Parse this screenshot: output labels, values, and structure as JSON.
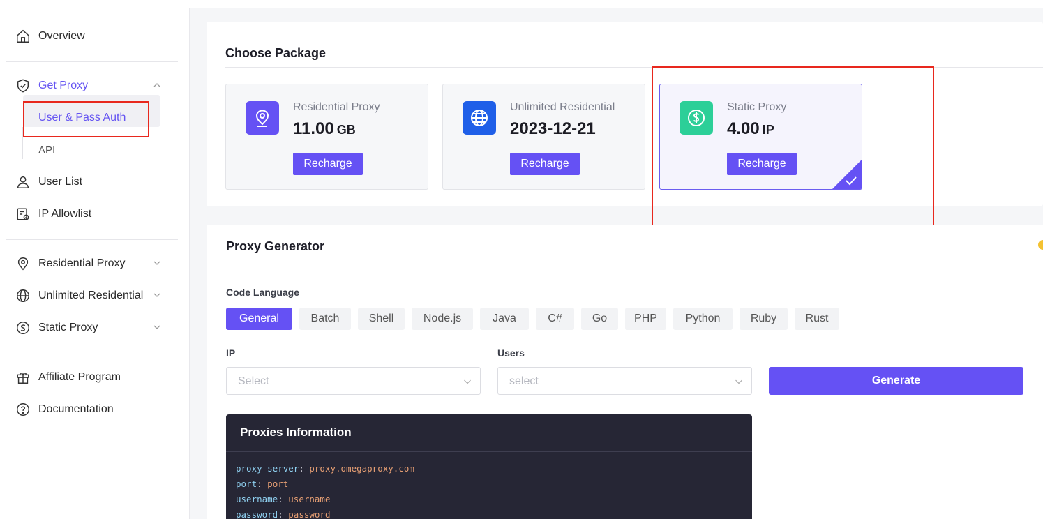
{
  "sidebar": {
    "overview": "Overview",
    "get_proxy": "Get Proxy",
    "user_pass_auth": "User & Pass Auth",
    "api": "API",
    "user_list": "User List",
    "ip_allowlist": "IP Allowlist",
    "residential_proxy": "Residential Proxy",
    "unlimited_residential": "Unlimited Residential",
    "static_proxy": "Static Proxy",
    "affiliate_program": "Affiliate Program",
    "documentation": "Documentation"
  },
  "package": {
    "title": "Choose Package",
    "items": [
      {
        "name": "Residential Proxy",
        "value": "11.00",
        "unit": "GB",
        "button": "Recharge",
        "color": "#6551f4"
      },
      {
        "name": "Unlimited Residential",
        "value": "2023-12-21",
        "unit": "",
        "button": "Recharge",
        "color": "#1f5fe8"
      },
      {
        "name": "Static Proxy",
        "value": "4.00",
        "unit": "IP",
        "button": "Recharge",
        "color": "#2ccf98",
        "selected": true
      }
    ]
  },
  "generator": {
    "title": "Proxy Generator",
    "code_language_label": "Code Language",
    "tabs": [
      "General",
      "Batch",
      "Shell",
      "Node.js",
      "Java",
      "C#",
      "Go",
      "PHP",
      "Python",
      "Ruby",
      "Rust"
    ],
    "active_tab": "General",
    "ip_label": "IP",
    "ip_placeholder": "Select",
    "users_label": "Users",
    "users_placeholder": "select",
    "generate_button": "Generate"
  },
  "proxies_info": {
    "title": "Proxies Information",
    "lines": [
      {
        "key": "proxy server",
        "value": "proxy.omegaproxy.com"
      },
      {
        "key": "port",
        "value": "port"
      },
      {
        "key": "username",
        "value": "username"
      },
      {
        "key": "password",
        "value": "password"
      }
    ]
  },
  "colors": {
    "accent": "#6551f4",
    "highlight_box": "#e8281e"
  }
}
